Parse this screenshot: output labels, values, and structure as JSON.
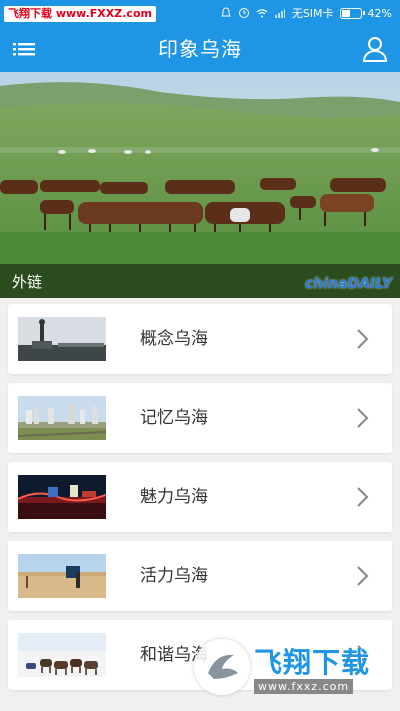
{
  "status_bar": {
    "watermark": "飞翔下载 www.FXXZ.com",
    "carrier": "无SIM卡",
    "battery": "42%"
  },
  "header": {
    "title": "印象乌海",
    "menu_icon": "menu-icon",
    "user_icon": "user-icon"
  },
  "banner": {
    "caption": "外链",
    "logo": "chinaDAILY"
  },
  "list": {
    "items": [
      {
        "label": "概念乌海",
        "thumb": "monument"
      },
      {
        "label": "记忆乌海",
        "thumb": "city"
      },
      {
        "label": "魅力乌海",
        "thumb": "night"
      },
      {
        "label": "活力乌海",
        "thumb": "desert"
      },
      {
        "label": "和谐乌海",
        "thumb": "horses"
      }
    ]
  },
  "watermark_bottom": {
    "brand": "飞翔下载",
    "url": "www.fxxz.com"
  },
  "colors": {
    "primary": "#1f95e6",
    "background": "#f0f0f0"
  }
}
